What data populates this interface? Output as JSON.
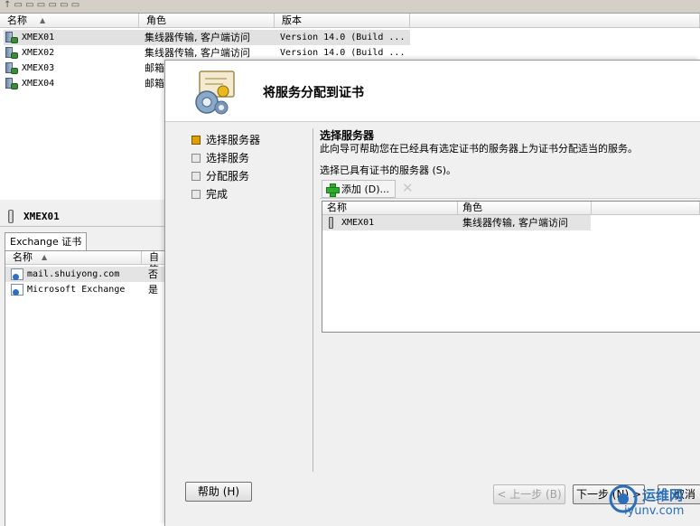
{
  "console": {
    "columns": [
      "名称",
      "角色",
      "版本"
    ],
    "rows": [
      {
        "name": "XMEX01",
        "role": "集线器传输, 客户端访问",
        "version": "Version 14.0 (Build ..."
      },
      {
        "name": "XMEX02",
        "role": "集线器传输, 客户端访问",
        "version": "Version 14.0 (Build ..."
      },
      {
        "name": "XMEX03",
        "role": "邮箱",
        "version": ""
      },
      {
        "name": "XMEX04",
        "role": "邮箱",
        "version": ""
      }
    ]
  },
  "detail": {
    "title": "XMEX01",
    "tab": "Exchange 证书",
    "columns": [
      "名称",
      "自签"
    ],
    "rows": [
      {
        "name": "mail.shuiyong.com",
        "self_signed": "否"
      },
      {
        "name": "Microsoft Exchange",
        "self_signed": "是"
      }
    ]
  },
  "wizard": {
    "title": "将服务分配到证书",
    "steps": [
      {
        "label": "选择服务器",
        "active": true
      },
      {
        "label": "选择服务",
        "active": false
      },
      {
        "label": "分配服务",
        "active": false
      },
      {
        "label": "完成",
        "active": false
      }
    ],
    "heading": "选择服务器",
    "description": "此向导可帮助您在已经具有选定证书的服务器上为证书分配适当的服务。",
    "list_label": "选择已具有证书的服务器 (S)。",
    "add_button": "添加 (D)...",
    "list_columns": [
      "名称",
      "角色"
    ],
    "list_rows": [
      {
        "name": "XMEX01",
        "role": "集线器传输, 客户端访问"
      }
    ],
    "help_button": "帮助 (H)",
    "back_button": "< 上一步 (B)",
    "next_button": "下一步 (N) >",
    "cancel_button": "取消"
  },
  "watermark": {
    "line1": "运维网",
    "line2": "iyunv.com"
  },
  "colors": {
    "accent": "#e2a000",
    "add_icon": "#2eac2e",
    "watermark": "#2a6fb8"
  }
}
